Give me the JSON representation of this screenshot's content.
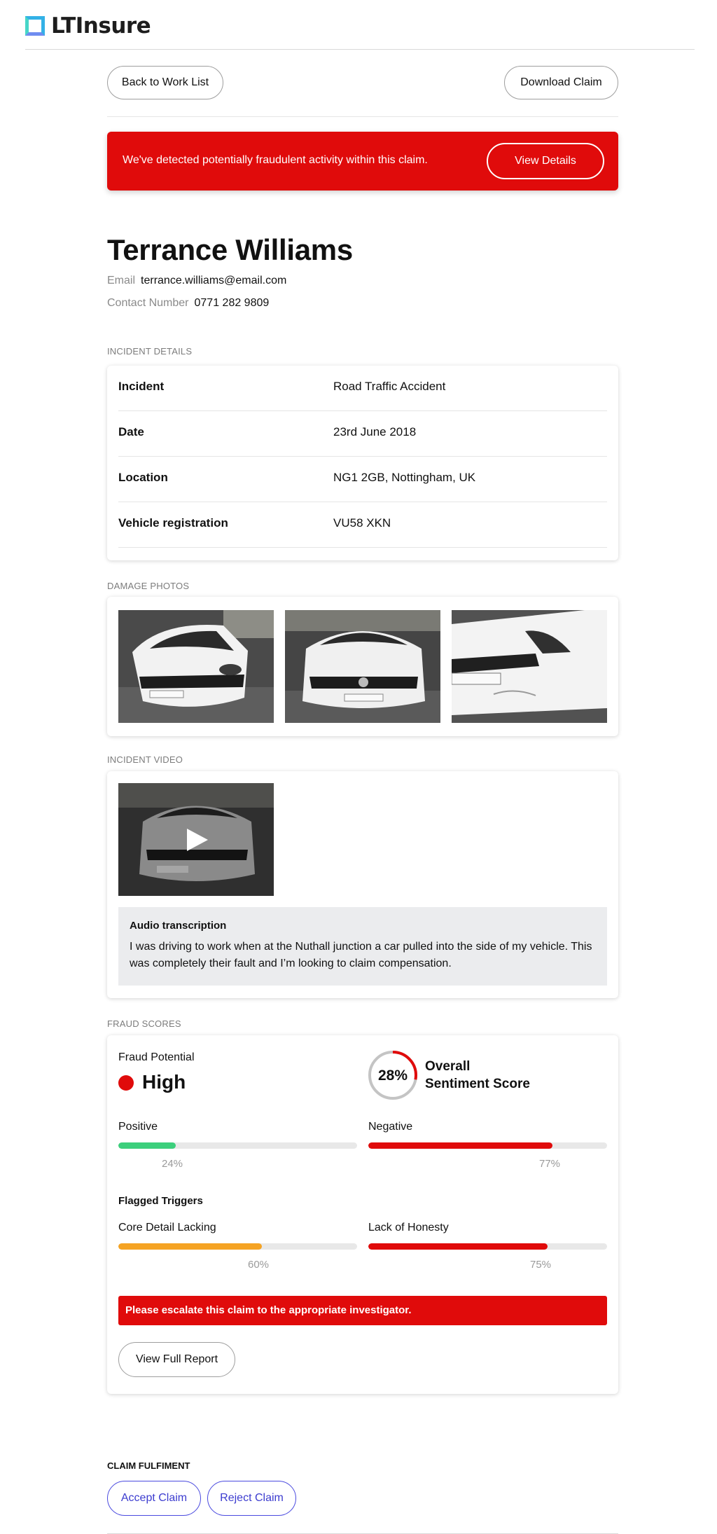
{
  "brand": {
    "name": "LTInsure",
    "logo_icon": "square-logo-icon"
  },
  "toolbar": {
    "back_label": "Back to Work List",
    "download_label": "Download Claim"
  },
  "alert": {
    "message": "We've detected potentially fraudulent activity within this claim.",
    "button_label": "View Details",
    "color": "#e00b0b"
  },
  "claimant": {
    "name": "Terrance Williams",
    "email_label": "Email",
    "email": "terrance.williams@email.com",
    "phone_label": "Contact Number",
    "phone": "0771 282 9809"
  },
  "incident": {
    "section_label": "INCIDENT DETAILS",
    "rows": [
      {
        "label": "Incident",
        "value": "Road Traffic Accident"
      },
      {
        "label": "Date",
        "value": "23rd June 2018"
      },
      {
        "label": "Location",
        "value": "NG1 2GB, Nottingham, UK"
      },
      {
        "label": "Vehicle registration",
        "value": "VU58 XKN"
      }
    ]
  },
  "photos": {
    "section_label": "DAMAGE PHOTOS",
    "count": 3
  },
  "video": {
    "section_label": "INCIDENT VIDEO",
    "play_icon": "play-icon",
    "transcription_title": "Audio transcription",
    "transcription_text": "I was driving to work when at the Nuthall junction a car pulled into the side of my vehicle. This was completely their fault and I’m looking to claim compensation."
  },
  "fraud": {
    "section_label": "FRAUD SCORES",
    "potential_label": "Fraud Potential",
    "potential_value": "High",
    "potential_color": "#e00b0b",
    "sentiment": {
      "value": 0.28,
      "text": "28%",
      "title_line1": "Overall",
      "title_line2": "Sentiment Score"
    },
    "positive": {
      "label": "Positive",
      "value": 0.24,
      "text": "24%",
      "color": "#3ccf7c"
    },
    "negative": {
      "label": "Negative",
      "value": 0.77,
      "text": "77%",
      "color": "#e00b0b"
    },
    "flagged_title": "Flagged Triggers",
    "core_detail": {
      "label": "Core Detail Lacking",
      "value": 0.6,
      "text": "60%",
      "color": "#f5a323"
    },
    "honesty": {
      "label": "Lack of Honesty",
      "value": 0.75,
      "text": "75%",
      "color": "#e00b0b"
    },
    "escalate_text": "Please escalate this claim to the appropriate investigator.",
    "report_button": "View Full Report"
  },
  "fulfilment": {
    "title": "CLAIM FULFIMENT",
    "accept_label": "Accept Claim",
    "reject_label": "Reject Claim",
    "accent": "#3c3ccf"
  }
}
